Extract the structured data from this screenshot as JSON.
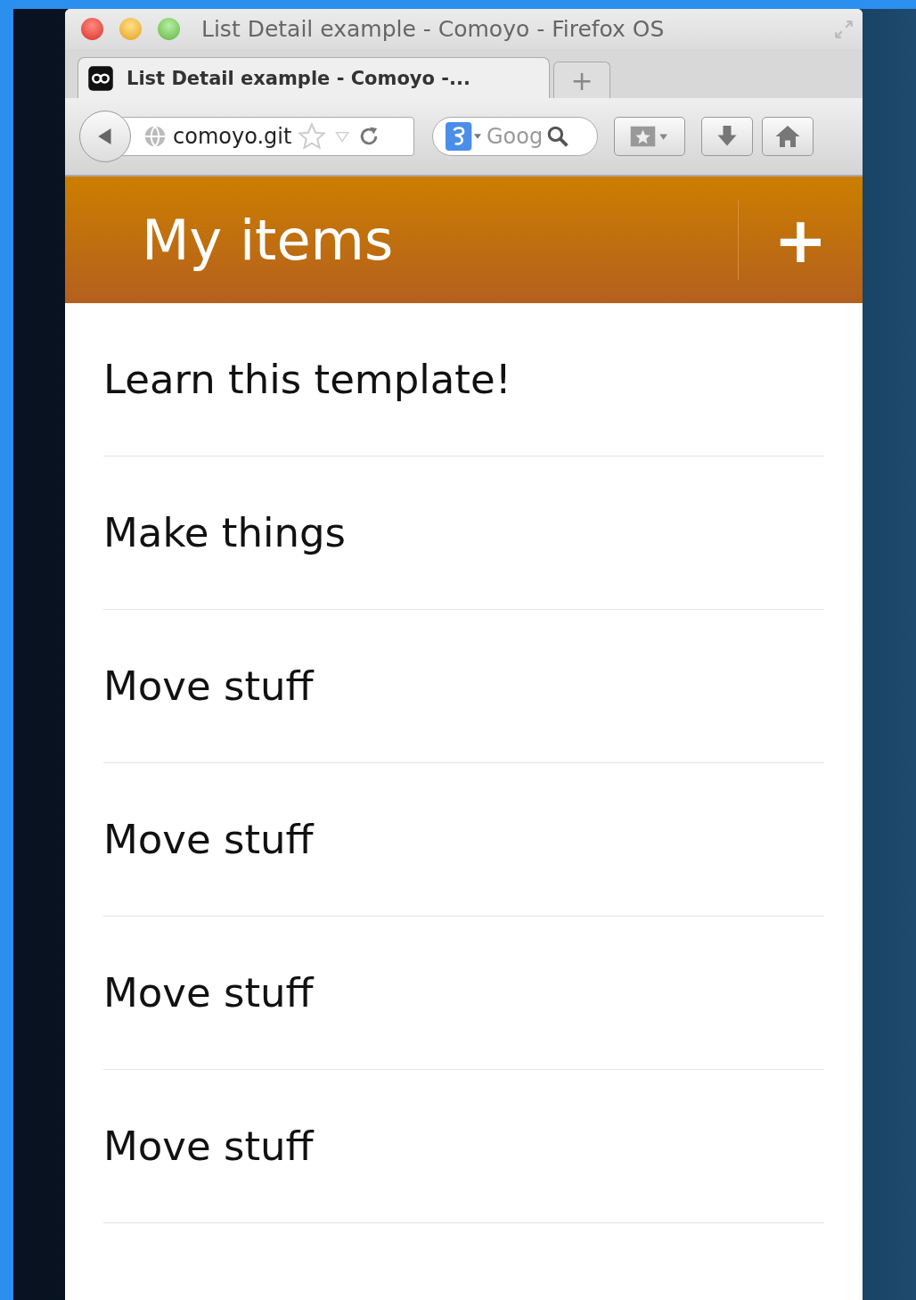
{
  "window": {
    "title": "List Detail example - Comoyo - Firefox OS"
  },
  "tabs": [
    {
      "label": "List Detail example - Comoyo -...",
      "selected": true
    }
  ],
  "new_tab": "+",
  "toolbar": {
    "url": "comoyo.git",
    "search": "Goog"
  },
  "app": {
    "title": "My items",
    "add": "+"
  },
  "items": [
    {
      "label": "Learn this template!"
    },
    {
      "label": "Make things"
    },
    {
      "label": "Move stuff"
    },
    {
      "label": "Move stuff"
    },
    {
      "label": "Move stuff"
    },
    {
      "label": "Move stuff"
    }
  ]
}
